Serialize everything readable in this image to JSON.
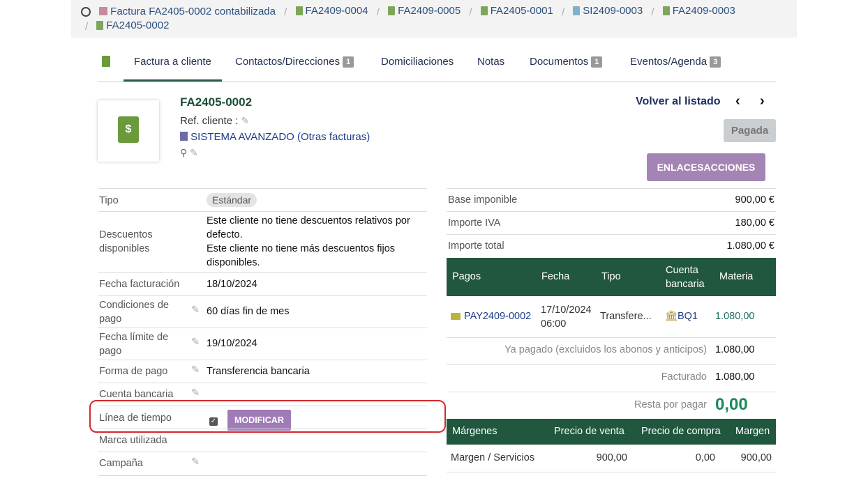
{
  "breadcrumb": {
    "items": [
      {
        "label": "Factura FA2405-0002 contabilizada",
        "icon": "calendar-icon"
      },
      {
        "label": "FA2409-0004",
        "icon": "invoice-icon"
      },
      {
        "label": "FA2409-0005",
        "icon": "invoice-icon"
      },
      {
        "label": "FA2405-0001",
        "icon": "invoice-icon"
      },
      {
        "label": "SI2409-0003",
        "icon": "supplier-invoice-icon"
      },
      {
        "label": "FA2409-0003",
        "icon": "invoice-icon"
      },
      {
        "label": "FA2405-0002",
        "icon": "invoice-icon"
      }
    ]
  },
  "tabs": [
    {
      "label": "Factura a cliente",
      "badge": null
    },
    {
      "label": "Contactos/Direcciones",
      "badge": "1"
    },
    {
      "label": "Domiciliaciones",
      "badge": null
    },
    {
      "label": "Notas",
      "badge": null
    },
    {
      "label": "Documentos",
      "badge": "1"
    },
    {
      "label": "Eventos/Agenda",
      "badge": "3"
    }
  ],
  "header": {
    "ref": "FA2405-0002",
    "ref_cliente_label": "Ref. cliente :",
    "company": "SISTEMA AVANZADO",
    "other_invoices": "(Otras facturas)",
    "back_label": "Volver al listado",
    "status": "Pagada",
    "links_button": "ENLACESACCIONES",
    "doc_symbol": "$"
  },
  "left": {
    "tipo_label": "Tipo",
    "tipo_value": "Estándar",
    "desc_label": "Descuentos disponibles",
    "desc_line1": "Este cliente no tiene descuentos relativos por defecto.",
    "desc_line2": "Este cliente no tiene más descuentos fijos disponibles.",
    "fecha_fact_label": "Fecha facturación",
    "fecha_fact_value": "18/10/2024",
    "cond_label": "Condiciones de pago",
    "cond_value": "60 días fin de mes",
    "limite_label": "Fecha límite de pago",
    "limite_value": "19/10/2024",
    "forma_label": "Forma de pago",
    "forma_value": "Transferencia bancaria",
    "cuenta_label": "Cuenta bancaria",
    "linea_label": "Línea de tiempo",
    "modificar": "MODIFICAR",
    "marca_label": "Marca utilizada",
    "campana_label": "Campaña"
  },
  "right": {
    "base_label": "Base imponible",
    "base_value": "900,00 €",
    "iva_label": "Importe IVA",
    "iva_value": "180,00 €",
    "total_label": "Importe total",
    "total_value": "1.080,00 €",
    "pagos_headers": [
      "Pagos",
      "Fecha",
      "Tipo",
      "Cuenta bancaria",
      "Materia"
    ],
    "payment": {
      "ref": "PAY2409-0002",
      "date": "17/10/2024",
      "time": "06:00",
      "type": "Transfere...",
      "account": "BQ1",
      "amount": "1.080,00"
    },
    "ya_pagado_label": "Ya pagado (excluidos los abonos y anticipos)",
    "ya_pagado_value": "1.080,00",
    "facturado_label": "Facturado",
    "facturado_value": "1.080,00",
    "resta_label": "Resta por pagar",
    "resta_value": "0,00",
    "margin_headers": [
      "Márgenes",
      "Precio de venta",
      "Precio de compra",
      "Margen"
    ],
    "margin_row": {
      "label": "Margen / Servicios",
      "venta": "900,00",
      "compra": "0,00",
      "margen": "900,00"
    }
  }
}
